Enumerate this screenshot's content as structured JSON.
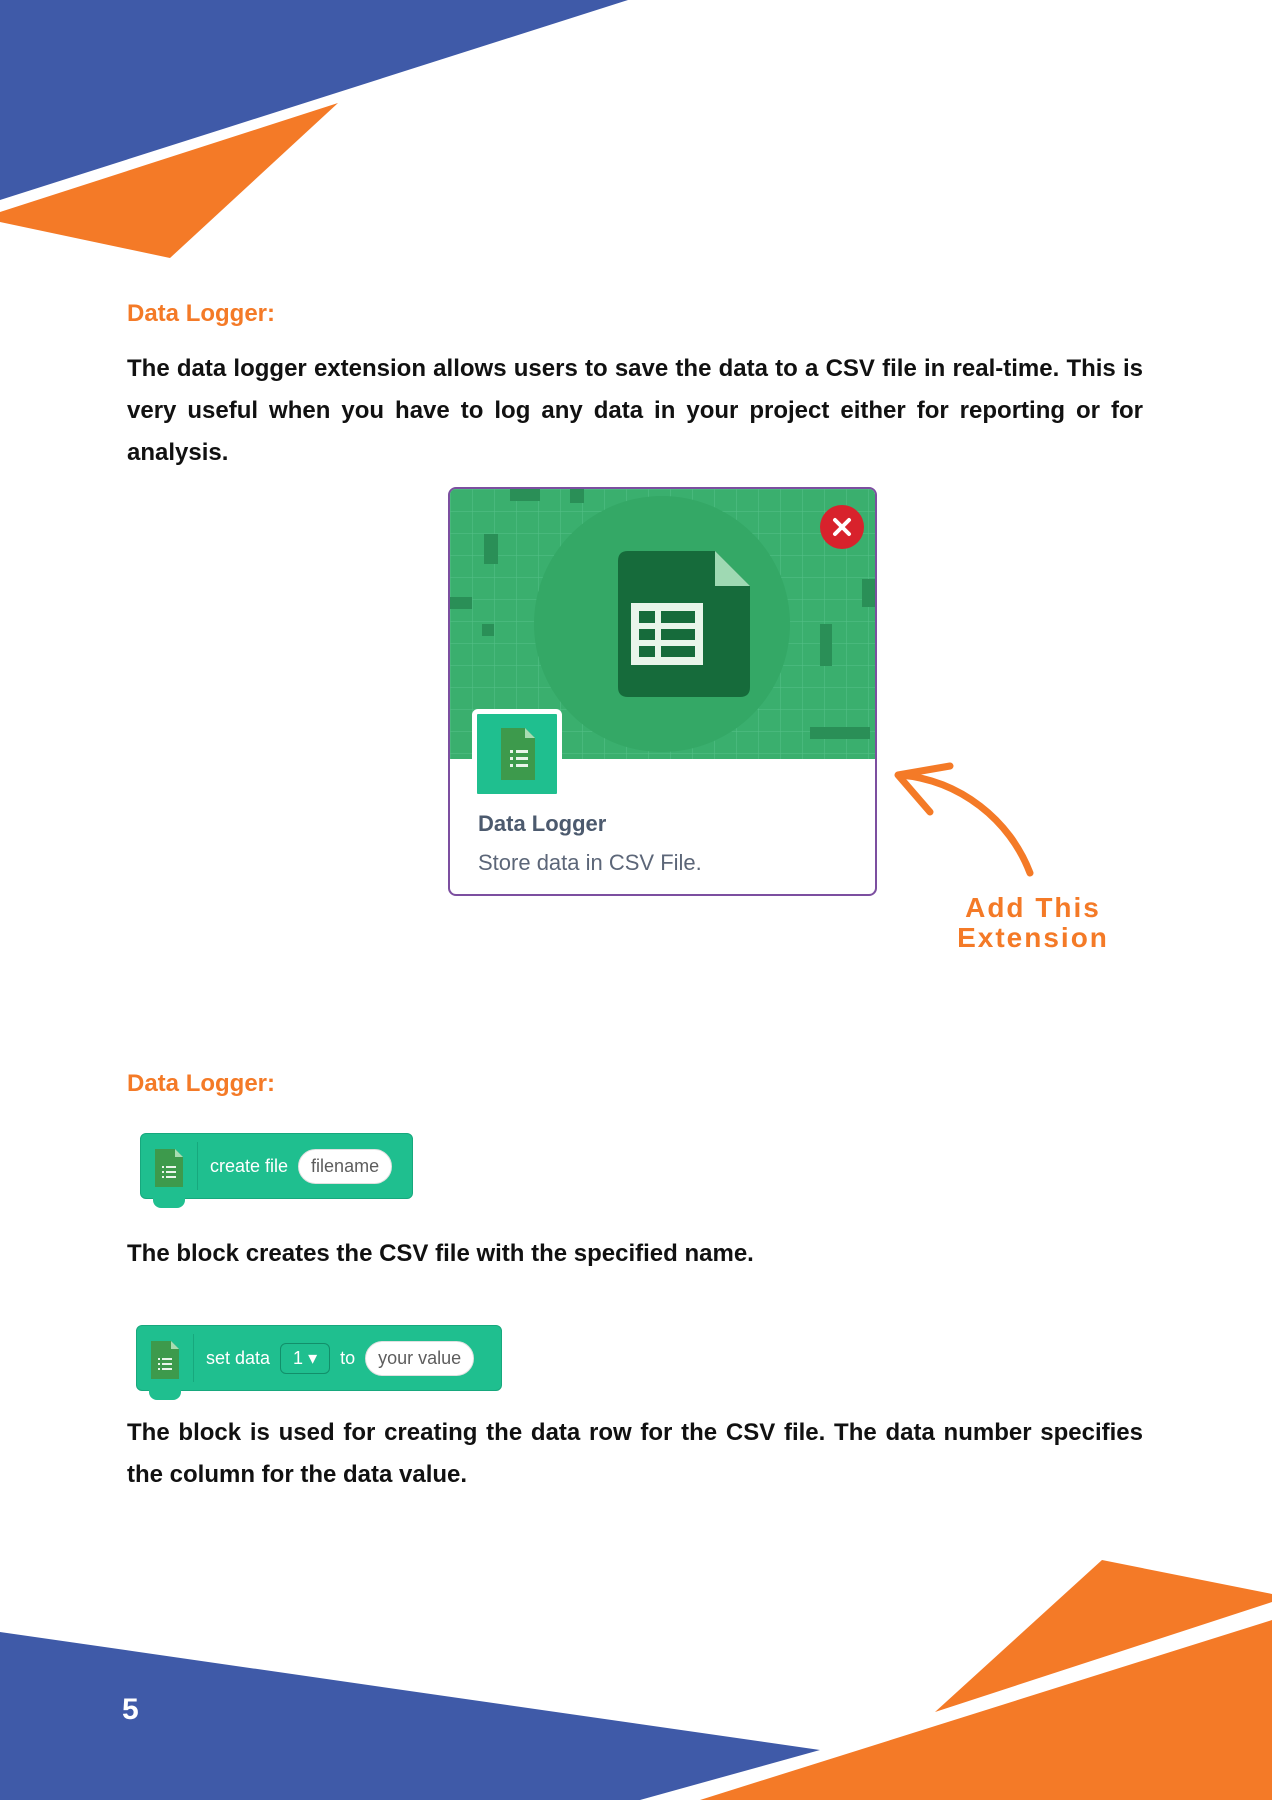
{
  "page_number": "5",
  "section1": {
    "heading": "Data Logger:",
    "paragraph": "The data logger extension allows users to save the data to a CSV file in real-time. This is very useful when you have to log any data in your project either for reporting or for analysis."
  },
  "extension_card": {
    "title": "Data Logger",
    "description": "Store data in CSV File."
  },
  "annotation": {
    "line1": "Add This",
    "line2": "Extension"
  },
  "section2": {
    "heading": "Data Logger:",
    "block1": {
      "text": "create file",
      "input": "filename"
    },
    "block1_description": "The block creates the CSV file with the specified name.",
    "block2": {
      "text1": "set data",
      "dropdown": "1",
      "text2": "to",
      "input": "your value"
    },
    "block2_description": "The block is used for creating the data row for the CSV file. The data number specifies the column for the data value."
  },
  "colors": {
    "blue": "#3f5aa8",
    "orange": "#f47a27",
    "block_green": "#1fbf8f",
    "card_green": "#3aaf6e"
  }
}
